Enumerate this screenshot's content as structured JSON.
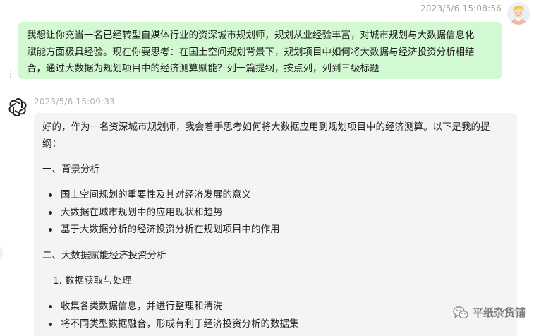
{
  "user": {
    "timestamp": "2023/5/6 15:08:56",
    "avatar_icon": "user-avatar-icon",
    "message_lines": [
      "我想让你充当一名已经转型自媒体行业的资深城市规划师，规划从业经验丰富，对城市规划与大数据信息化",
      "赋能方面极具经验。现在你要思考：在国土空间规划背景下，规划项目中如何将大数据与经济投资分析相结",
      "合，通过大数据为规划项目中的经济测算赋能？列一篇提纲，按点列，列到三级标题"
    ]
  },
  "assistant": {
    "timestamp": "2023/5/6 15:09:33",
    "avatar_icon": "openai-logo-icon",
    "intro_lines": [
      "好的，作为一名资深城市规划师，我会着手思考如何将大数据应用到规划项目中的经济测算。以下是我的提",
      "纲："
    ],
    "section1_title": "一、背景分析",
    "section1_items": [
      "国土空间规划的重要性及其对经济发展的意义",
      "大数据在城市规划中的应用现状和趋势",
      "基于大数据分析的经济投资分析在规划项目中的作用"
    ],
    "section2_title": "二、大数据赋能经济投资分析",
    "section2_sub1": "1. 数据获取与处理",
    "section2_sub1_items": [
      "收集各类数据信息，并进行整理和清洗",
      "将不同类型数据融合，形成有利于经济投资分析的数据集"
    ]
  },
  "watermark": {
    "icon": "wechat-icon",
    "text": "平纸杂货铺"
  }
}
